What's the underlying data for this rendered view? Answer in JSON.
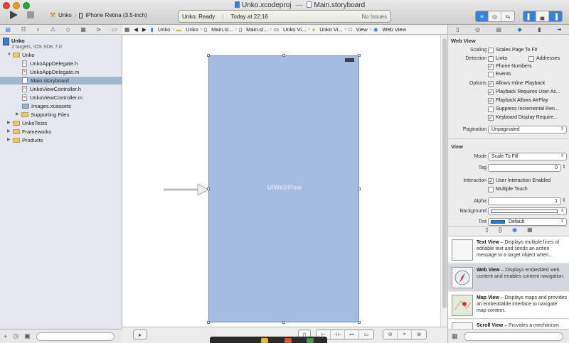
{
  "window": {
    "title": "Unko.xcodeproj",
    "document": "Main.storyboard",
    "separator": "—"
  },
  "toolbar": {
    "scheme": "Unko",
    "destination": "iPhone Retina (3.5-inch)",
    "status": "Unko: Ready",
    "time": "Today at 22:16",
    "issues": "No Issues"
  },
  "navigator": {
    "project": "Unko",
    "project_sub": "2 targets, iOS SDK 7.0",
    "items": [
      {
        "label": "Unko",
        "type": "folder"
      },
      {
        "label": "UnkoAppDelegate.h",
        "type": "h"
      },
      {
        "label": "UnkoAppDelegate.m",
        "type": "m"
      },
      {
        "label": "Main.storyboard",
        "type": "storyboard"
      },
      {
        "label": "UnkoViewController.h",
        "type": "h"
      },
      {
        "label": "UnkoViewController.m",
        "type": "m"
      },
      {
        "label": "Images.xcassets",
        "type": "assets"
      },
      {
        "label": "Supporting Files",
        "type": "folder"
      },
      {
        "label": "UnkoTests",
        "type": "folder"
      },
      {
        "label": "Frameworks",
        "type": "folder"
      },
      {
        "label": "Products",
        "type": "folder"
      }
    ]
  },
  "jumpbar": [
    "Unko",
    "Unko",
    "Main.st...",
    "Main.st...",
    "Unko Vi...",
    "Unko Vi...",
    "View",
    "Web View"
  ],
  "canvas": {
    "web_view_label": "UIWebView"
  },
  "inspector": {
    "web_view_section": "Web View",
    "scaling_label": "Scaling",
    "scales_page_to_fit": "Scales Page To Fit",
    "detection_label": "Detection",
    "links": "Links",
    "addresses": "Addresses",
    "phone_numbers": "Phone Numbers",
    "events": "Events",
    "options_label": "Options",
    "allows_inline": "Allows Inline Playback",
    "playback_requires": "Playback Requires User Ac...",
    "playback_airplay": "Playback Allows AirPlay",
    "suppress": "Suppress Incremental Ren...",
    "keyboard": "Keyboard Display Require...",
    "pagination_label": "Pagination",
    "pagination_value": "Unpaginated",
    "view_section": "View",
    "mode_label": "Mode",
    "mode_value": "Scale To Fill",
    "tag_label": "Tag",
    "tag_value": "0",
    "interaction_label": "Interaction",
    "user_interaction": "User Interaction Enabled",
    "multiple_touch": "Multiple Touch",
    "alpha_label": "Alpha",
    "alpha_value": "1",
    "background_label": "Background",
    "tint_label": "Tint",
    "tint_value": "Default",
    "tint_color": "#2a7fd4"
  },
  "library": [
    {
      "name": "Text View",
      "desc": " – Displays multiple lines of editable text and sends an action message to a target object when..."
    },
    {
      "name": "Web View",
      "desc": " – Displays embedded web content and enables content navigation."
    },
    {
      "name": "Map View",
      "desc": " – Displays maps and provides an embeddable interface to navigate map content."
    },
    {
      "name": "Scroll View",
      "desc": " – Provides a mechanism"
    }
  ]
}
